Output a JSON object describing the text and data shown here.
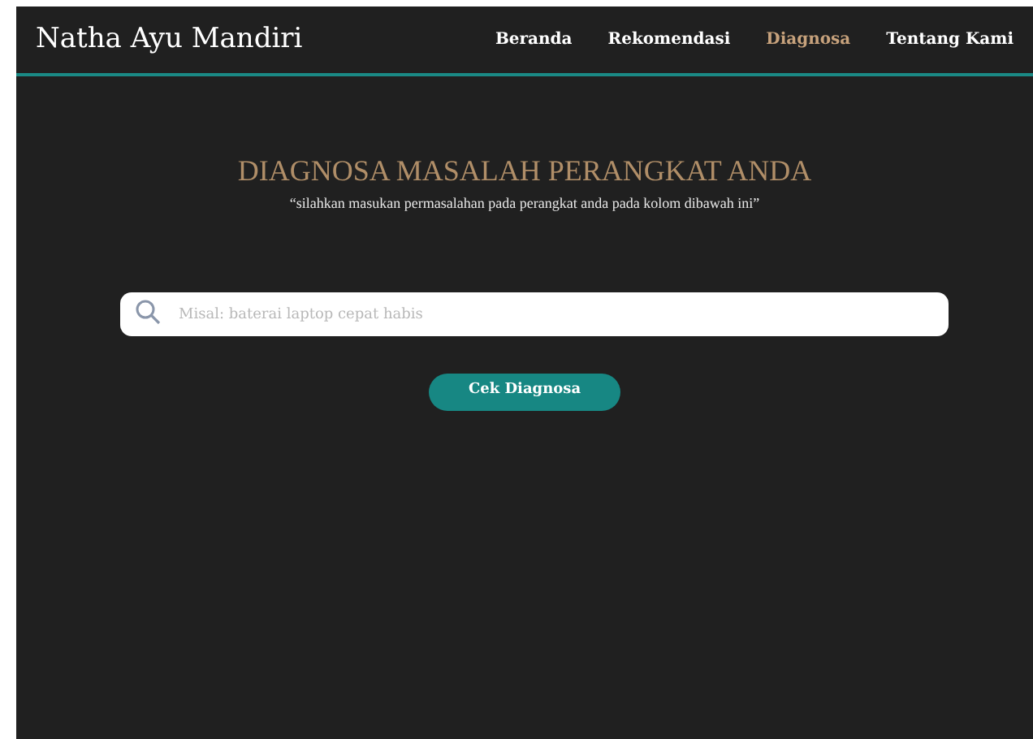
{
  "brand": "Natha Ayu Mandiri",
  "nav": [
    {
      "label": "Beranda",
      "selected": false
    },
    {
      "label": "Rekomendasi",
      "selected": false
    },
    {
      "label": "Diagnosa",
      "selected": true
    },
    {
      "label": "Tentang Kami",
      "selected": false
    }
  ],
  "heading": "DIAGNOSA MASALAH PERANGKAT ANDA",
  "subheading": "“silahkan masukan permasalahan pada perangkat anda pada kolom dibawah ini”",
  "search": {
    "placeholder": "Misal: baterai laptop cepat habis"
  },
  "button": "Cek Diagnosa"
}
